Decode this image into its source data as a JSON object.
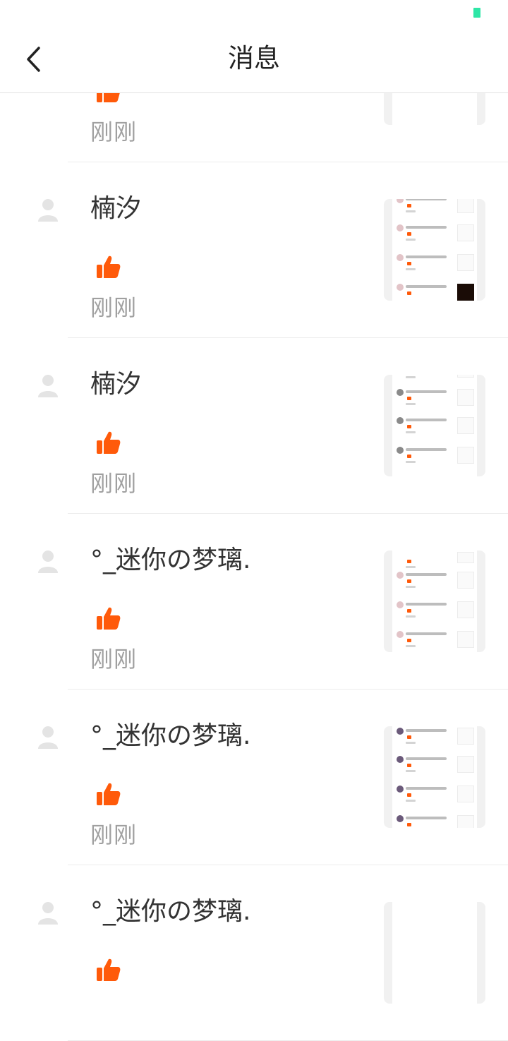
{
  "status_bar": {
    "battery_color": "#2ee6a6"
  },
  "header": {
    "title": "消息",
    "back_icon": "chevron-left-icon"
  },
  "colors": {
    "like": "#ff5a0a",
    "time_text": "#a0a0a0",
    "avatar_placeholder": "#e4e4e4"
  },
  "messages": [
    {
      "name": "",
      "time": "刚刚",
      "icon": "thumbs-up-icon"
    },
    {
      "name": "楠汐",
      "time": "刚刚",
      "icon": "thumbs-up-icon"
    },
    {
      "name": "楠汐",
      "time": "刚刚",
      "icon": "thumbs-up-icon"
    },
    {
      "name": "°_迷你の梦璃.",
      "time": "刚刚",
      "icon": "thumbs-up-icon"
    },
    {
      "name": "°_迷你の梦璃.",
      "time": "刚刚",
      "icon": "thumbs-up-icon"
    },
    {
      "name": "°_迷你の梦璃.",
      "time": "",
      "icon": "thumbs-up-icon"
    }
  ]
}
